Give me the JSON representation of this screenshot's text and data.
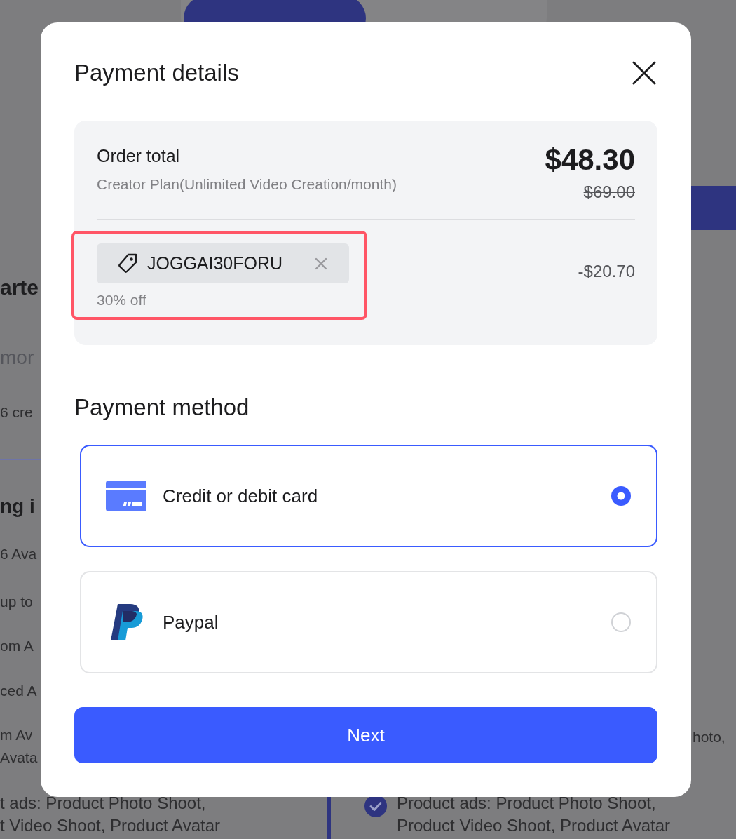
{
  "background": {
    "billing_toggle": [
      {
        "selected": true
      },
      {
        "selected": false
      }
    ],
    "left_column": [
      {
        "kind": "title",
        "text": "arte"
      },
      {
        "kind": "muted",
        "text": "mor"
      },
      {
        "kind": "body",
        "text": "6 cre"
      },
      {
        "kind": "heading",
        "text": "ng i"
      },
      {
        "kind": "body",
        "text": "6 Ava"
      },
      {
        "kind": "body",
        "text": "up to"
      },
      {
        "kind": "body",
        "text": "om A"
      },
      {
        "kind": "body",
        "text": "ced A"
      },
      {
        "kind": "body",
        "text": "m Av"
      },
      {
        "kind": "body",
        "text": "Avata"
      }
    ],
    "right_column": [
      {
        "kind": "body",
        "text": "hoto,"
      }
    ],
    "left_bottom_lines": [
      "t ads: Product Photo Shoot,",
      "t Video Shoot, Product Avatar"
    ],
    "right_feature": {
      "checked": true,
      "text": "Product ads: Product Photo Shoot, Product Video Shoot, Product Avatar"
    }
  },
  "dialog": {
    "title": "Payment details",
    "order": {
      "label": "Order total",
      "plan": "Creator Plan(Unlimited Video Creation/month)",
      "total": "$48.30",
      "original_price": "$69.00"
    },
    "coupon": {
      "code": "JOGGAI30FORU",
      "note": "30% off",
      "discount": "-$20.70",
      "highlighted": true
    },
    "payment_method_title": "Payment method",
    "methods": [
      {
        "kind": "card",
        "label": "Credit or debit card",
        "selected": true
      },
      {
        "kind": "paypal",
        "label": "Paypal",
        "selected": false
      }
    ],
    "next_button": "Next"
  }
}
